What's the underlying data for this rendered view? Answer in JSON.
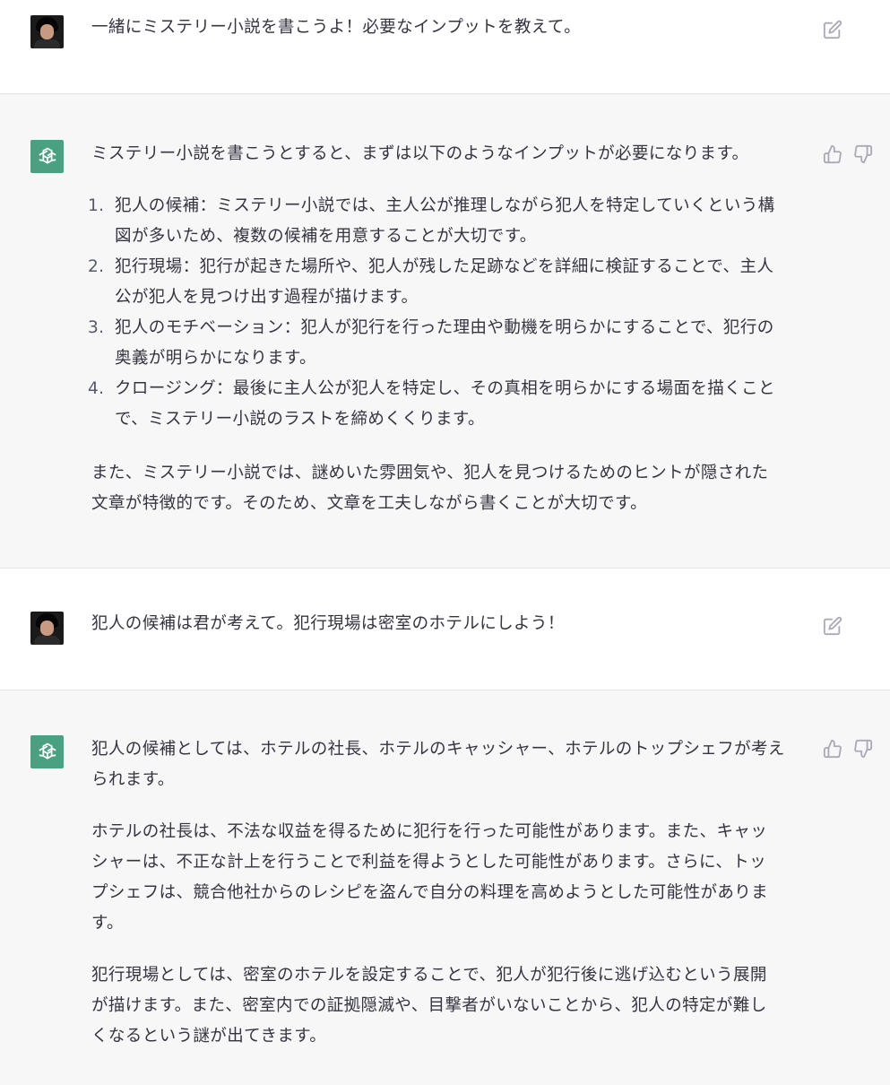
{
  "conversation": [
    {
      "role": "user",
      "text": "一緒にミステリー小説を書こうよ！必要なインプットを教えて。"
    },
    {
      "role": "assistant",
      "intro": "ミステリー小説を書こうとすると、まずは以下のようなインプットが必要になります。",
      "list": [
        {
          "num": "1.",
          "line1": "犯人の候補：ミステリー小説では、主人公が推理しながら犯人を特定していくという構",
          "line2": "図が多いため、複数の候補を用意することが大切です。"
        },
        {
          "num": "2.",
          "line1": "犯行現場：犯行が起きた場所や、犯人が残した足跡などを詳細に検証することで、主人",
          "line2": "公が犯人を見つけ出す過程が描けます。"
        },
        {
          "num": "3.",
          "line1": "犯人のモチベーション：犯人が犯行を行った理由や動機を明らかにすることで、犯行の",
          "line2": "奥義が明らかになります。"
        },
        {
          "num": "4.",
          "line1": "クロージング：最後に主人公が犯人を特定し、その真相を明らかにする場面を描くこと",
          "line2": "で、ミステリー小説のラストを締めくくります。"
        }
      ],
      "outro_line1": "また、ミステリー小説では、謎めいた雰囲気や、犯人を見つけるためのヒントが隠された",
      "outro_line2": "文章が特徴的です。そのため、文章を工夫しながら書くことが大切です。"
    },
    {
      "role": "user",
      "text": "犯人の候補は君が考えて。犯行現場は密室のホテルにしよう！"
    },
    {
      "role": "assistant",
      "p1_line1": "犯人の候補としては、ホテルの社長、ホテルのキャッシャー、ホテルのトップシェフが考え",
      "p1_line2": "られます。",
      "p2_line1": "ホテルの社長は、不法な収益を得るために犯行を行った可能性があります。また、キャッ",
      "p2_line2": "シャーは、不正な計上を行うことで利益を得ようとした可能性があります。さらに、トッ",
      "p2_line3": "プシェフは、競合他社からのレシピを盗んで自分の料理を高めようとした可能性がありま",
      "p2_line4": "す。",
      "p3_line1": "犯行現場としては、密室のホテルを設定することで、犯人が犯行後に逃げ込むという展開",
      "p3_line2": "が描けます。また、密室内での証拠隠滅や、目撃者がいないことから、犯人の特定が難し",
      "p3_line3": "くなるという謎が出てきます。"
    }
  ],
  "icons": {
    "edit": "edit-icon",
    "thumbs_up": "thumbs-up-icon",
    "thumbs_down": "thumbs-down-icon",
    "bot_logo": "openai-logo-icon"
  },
  "colors": {
    "bot_avatar": "#4aa181",
    "assistant_bg": "#f7f7f8",
    "text": "#343541",
    "icon": "#a9aab6"
  }
}
